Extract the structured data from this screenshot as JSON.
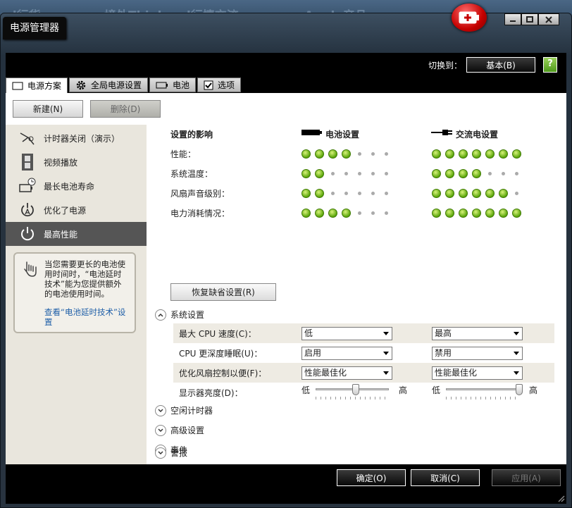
{
  "background": {
    "texts": [
      "ad行货",
      "境外Thinkpad行情交流",
      "Apple产品"
    ]
  },
  "window": {
    "title": "电源管理器"
  },
  "topbar": {
    "switch_label": "切换到：",
    "switch_button": "基本(B)",
    "help_label": "?"
  },
  "tabs": [
    {
      "label": "电源方案",
      "icon": "page-icon"
    },
    {
      "label": "全局电源设置",
      "icon": "gear-icon"
    },
    {
      "label": "电池",
      "icon": "battery-icon"
    },
    {
      "label": "选项",
      "icon": "checkbox-icon"
    }
  ],
  "toolbar": {
    "new": "新建(N)",
    "delete": "删除(D)"
  },
  "plans": [
    {
      "label": "计时器关闭（演示）",
      "icon": "projector-icon"
    },
    {
      "label": "视频播放",
      "icon": "film-icon"
    },
    {
      "label": "最长电池寿命",
      "icon": "battery-clock-icon"
    },
    {
      "label": "优化了电源",
      "icon": "power-a-icon"
    },
    {
      "label": "最高性能",
      "icon": "power-icon",
      "active": true
    }
  ],
  "tip": {
    "text": "当您需要更长的电池使用时间时，“电池延时技术”能为您提供额外的电池使用时间。",
    "link": "查看“电池延时技术”设置"
  },
  "impact": {
    "heading": "设置的影响",
    "battery_header": "电池设置",
    "ac_header": "交流电设置",
    "rows": [
      {
        "label": "性能：",
        "battery": 4,
        "ac": 7
      },
      {
        "label": "系统温度：",
        "battery": 2,
        "ac": 4
      },
      {
        "label": "风扇声音级别：",
        "battery": 2,
        "ac": 6
      },
      {
        "label": "电力消耗情况：",
        "battery": 4,
        "ac": 7
      }
    ],
    "max_dots": 7
  },
  "restore_button": "恢复缺省设置(R)",
  "system_settings": {
    "title": "系统设置",
    "rows": [
      {
        "label": "最大 CPU 速度(C)：",
        "battery": "低",
        "ac": "最高"
      },
      {
        "label": "CPU 更深度睡眠(U)：",
        "battery": "启用",
        "ac": "禁用"
      },
      {
        "label": "优化风扇控制以便(F)：",
        "battery": "性能最佳化",
        "ac": "性能最佳化"
      }
    ],
    "brightness": {
      "label": "显示器亮度(D)：",
      "low": "低",
      "high": "高",
      "battery_level": 0.55,
      "ac_level": 1.0
    }
  },
  "sections": [
    "空闲计时器",
    "高级设置",
    "事件",
    "警报"
  ],
  "footer": {
    "ok": "确定(O)",
    "cancel": "取消(C)",
    "apply": "应用(A)"
  }
}
